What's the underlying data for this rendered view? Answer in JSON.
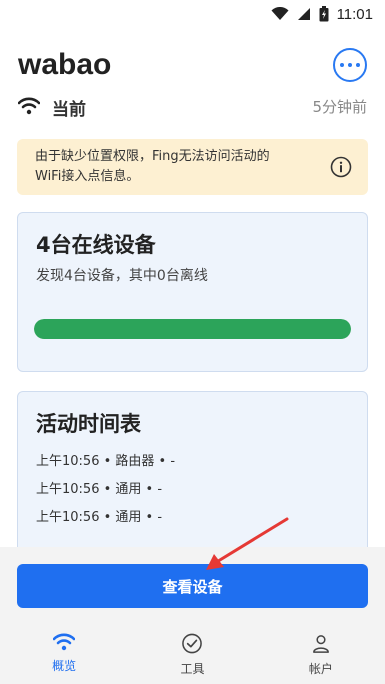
{
  "status_bar": {
    "time": "11:01"
  },
  "header": {
    "title": "wabao"
  },
  "network": {
    "label": "当前",
    "time_ago": "5分钟前"
  },
  "warning": {
    "line1": "由于缺少位置权限，Fing无法访问活动的",
    "line2": "WiFi接入点信息。"
  },
  "online_card": {
    "title": "4台在线设备",
    "subtitle": "发现4台设备，其中0台离线",
    "online_fraction": 1.0
  },
  "activity_card": {
    "title": "活动时间表",
    "items": [
      "上午10:56 • 路由器 • -",
      "上午10:56 • 通用 • -",
      "上午10:56 • 通用 • -"
    ]
  },
  "primary_button": {
    "label": "查看设备"
  },
  "bottom_nav": {
    "items": [
      {
        "label": "概览"
      },
      {
        "label": "工具"
      },
      {
        "label": "帐户"
      }
    ]
  },
  "colors": {
    "accent": "#1f6ff0",
    "success": "#2ca45a",
    "warning_bg": "#fdf0d2",
    "card_bg": "#eef4fc",
    "annotation_arrow": "#e53935"
  },
  "icons": [
    "wifi-icon",
    "battery-icon",
    "more-icon",
    "info-icon",
    "tools-icon",
    "account-icon"
  ]
}
